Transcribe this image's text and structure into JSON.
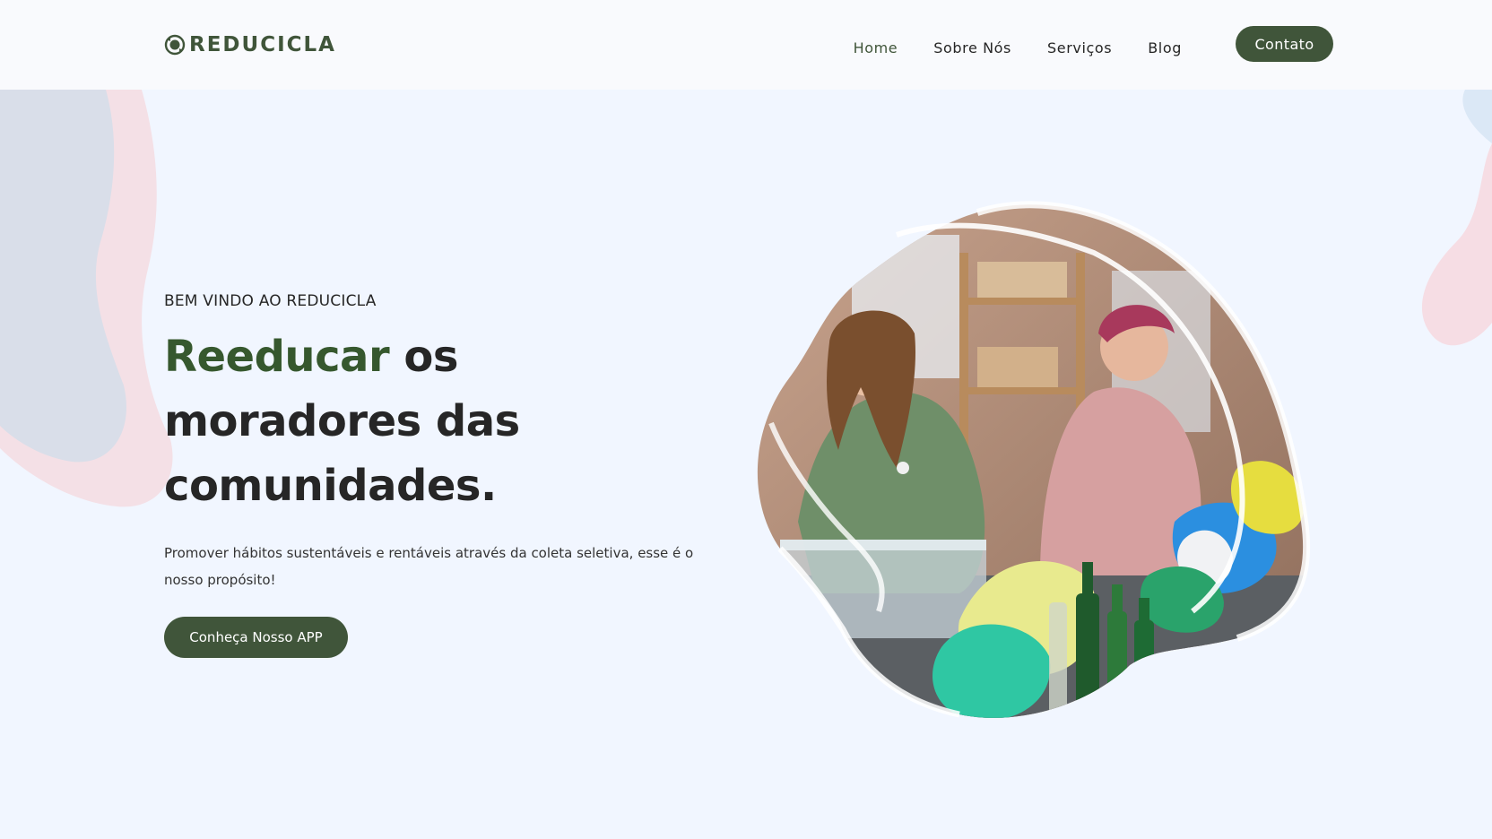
{
  "brand": {
    "name": "REDUCICLA",
    "icon": "recycle-globe-icon",
    "color": "#40553a"
  },
  "nav": {
    "items": [
      {
        "label": "Home",
        "active": true
      },
      {
        "label": "Sobre Nós",
        "active": false
      },
      {
        "label": "Serviços",
        "active": false
      },
      {
        "label": "Blog",
        "active": false
      }
    ],
    "cta_label": "Contato"
  },
  "hero": {
    "eyebrow": "BEM VINDO AO REDUCICLA",
    "headline_accent": "Reeducar",
    "headline_rest_1": " os",
    "headline_rest_2": "moradores das",
    "headline_rest_3": "comunidades.",
    "subtitle": "Promover hábitos sustentáveis e rentáveis através da coleta seletiva, esse é o nosso propósito!",
    "button_label": "Conheça Nosso APP"
  },
  "colors": {
    "accent": "#40553a",
    "headline_accent": "#36582e",
    "background": "#f1f6ff"
  }
}
